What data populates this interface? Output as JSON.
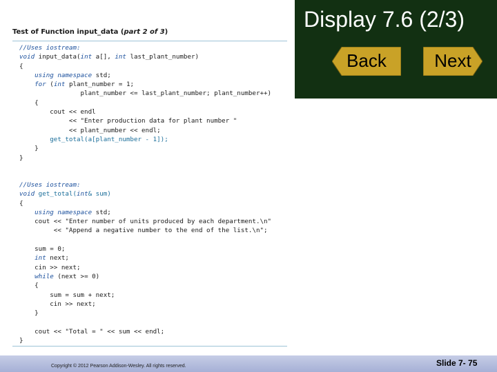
{
  "slide": {
    "title": "Display 7.6 (2/3)",
    "back_label": "Back",
    "next_label": "Next",
    "copyright": "Copyright © 2012 Pearson Addison-Wesley. All rights reserved.",
    "slide_number": "Slide 7- 75"
  },
  "colors": {
    "title_panel": "#123012",
    "button_fill": "#c9a227",
    "footer_bar": "#b4bddc",
    "code_keyword": "#1a4f9c",
    "rule": "#9cc3d6"
  },
  "display": {
    "title_bold": "Test of Function input_data (",
    "title_italic": "part 2 of 3",
    "title_end": ")"
  },
  "code_block_1": [
    [
      {
        "t": "//Uses iostream:",
        "c": "blue"
      }
    ],
    [
      {
        "t": "void",
        "c": "blue"
      },
      {
        "t": " input_data(",
        "c": "plain"
      },
      {
        "t": "int",
        "c": "blue"
      },
      {
        "t": " a[], ",
        "c": "plain"
      },
      {
        "t": "int",
        "c": "blue"
      },
      {
        "t": " last_plant_number)",
        "c": "plain"
      }
    ],
    [
      {
        "t": "{",
        "c": "plain"
      }
    ],
    [
      {
        "t": "    ",
        "c": "plain"
      },
      {
        "t": "using namespace",
        "c": "blue"
      },
      {
        "t": " std;",
        "c": "plain"
      }
    ],
    [
      {
        "t": "    ",
        "c": "plain"
      },
      {
        "t": "for",
        "c": "blue"
      },
      {
        "t": " (",
        "c": "plain"
      },
      {
        "t": "int",
        "c": "blue"
      },
      {
        "t": " plant_number = 1;",
        "c": "plain"
      }
    ],
    [
      {
        "t": "                plant_number <= last_plant_number; plant_number++)",
        "c": "plain"
      }
    ],
    [
      {
        "t": "    {",
        "c": "plain"
      }
    ],
    [
      {
        "t": "        cout << endl",
        "c": "plain"
      }
    ],
    [
      {
        "t": "             << \"Enter production data for plant number \"",
        "c": "plain"
      }
    ],
    [
      {
        "t": "             << plant_number << endl;",
        "c": "plain"
      }
    ],
    [
      {
        "t": "        get_total(a[plant_number - 1]);",
        "c": "teal"
      }
    ],
    [
      {
        "t": "    }",
        "c": "plain"
      }
    ],
    [
      {
        "t": "}",
        "c": "plain"
      }
    ]
  ],
  "code_block_2": [
    [
      {
        "t": "//Uses iostream:",
        "c": "blue"
      }
    ],
    [
      {
        "t": "void",
        "c": "blue"
      },
      {
        "t": " get_total(",
        "c": "teal"
      },
      {
        "t": "int",
        "c": "blue"
      },
      {
        "t": "& sum)",
        "c": "teal"
      }
    ],
    [
      {
        "t": "{",
        "c": "plain"
      }
    ],
    [
      {
        "t": "    ",
        "c": "plain"
      },
      {
        "t": "using namespace",
        "c": "blue"
      },
      {
        "t": " std;",
        "c": "plain"
      }
    ],
    [
      {
        "t": "    cout << \"Enter number of units produced by each department.\\n\"",
        "c": "plain"
      }
    ],
    [
      {
        "t": "         << \"Append a negative number to the end of the list.\\n\";",
        "c": "plain"
      }
    ],
    [
      {
        "t": "",
        "c": "plain"
      }
    ],
    [
      {
        "t": "    sum = 0;",
        "c": "plain"
      }
    ],
    [
      {
        "t": "    ",
        "c": "plain"
      },
      {
        "t": "int",
        "c": "blue"
      },
      {
        "t": " next;",
        "c": "plain"
      }
    ],
    [
      {
        "t": "    cin >> next;",
        "c": "plain"
      }
    ],
    [
      {
        "t": "    ",
        "c": "plain"
      },
      {
        "t": "while",
        "c": "blue"
      },
      {
        "t": " (next >= 0)",
        "c": "plain"
      }
    ],
    [
      {
        "t": "    {",
        "c": "plain"
      }
    ],
    [
      {
        "t": "        sum = sum + next;",
        "c": "plain"
      }
    ],
    [
      {
        "t": "        cin >> next;",
        "c": "plain"
      }
    ],
    [
      {
        "t": "    }",
        "c": "plain"
      }
    ],
    [
      {
        "t": "",
        "c": "plain"
      }
    ],
    [
      {
        "t": "    cout << \"Total = \" << sum << endl;",
        "c": "plain"
      }
    ],
    [
      {
        "t": "}",
        "c": "plain"
      }
    ]
  ]
}
